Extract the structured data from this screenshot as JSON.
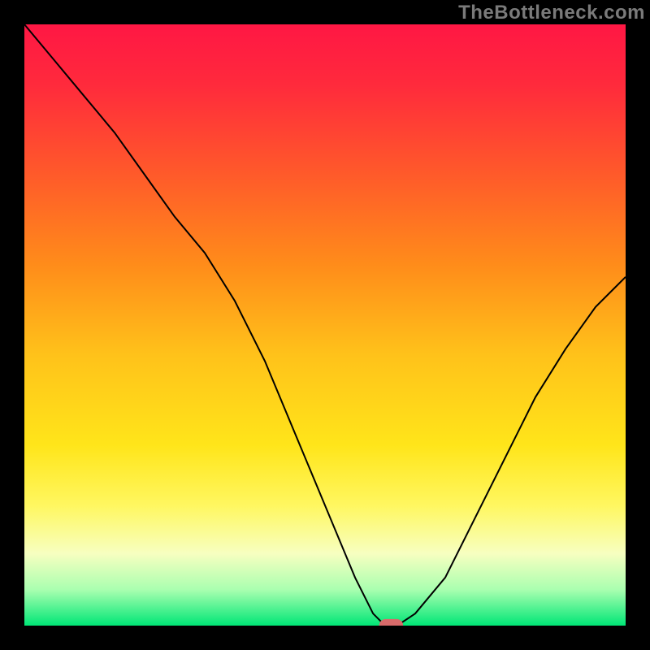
{
  "watermark": "TheBottleneck.com",
  "chart_data": {
    "type": "line",
    "title": "",
    "xlabel": "",
    "ylabel": "",
    "xlim": [
      0,
      100
    ],
    "ylim": [
      0,
      100
    ],
    "grid": false,
    "legend": false,
    "background": {
      "type": "vertical-gradient",
      "stops": [
        {
          "offset": 0.0,
          "color": "#ff1744"
        },
        {
          "offset": 0.1,
          "color": "#ff2a3c"
        },
        {
          "offset": 0.25,
          "color": "#ff5a2a"
        },
        {
          "offset": 0.4,
          "color": "#ff8c1a"
        },
        {
          "offset": 0.55,
          "color": "#ffc21a"
        },
        {
          "offset": 0.7,
          "color": "#ffe51a"
        },
        {
          "offset": 0.8,
          "color": "#fff760"
        },
        {
          "offset": 0.88,
          "color": "#f7ffc0"
        },
        {
          "offset": 0.94,
          "color": "#aaffb0"
        },
        {
          "offset": 1.0,
          "color": "#00e676"
        }
      ]
    },
    "series": [
      {
        "name": "bottleneck-curve",
        "color": "#000000",
        "stroke_width": 2,
        "x": [
          0,
          5,
          10,
          15,
          20,
          25,
          30,
          35,
          40,
          45,
          50,
          55,
          58,
          60,
          62,
          65,
          70,
          75,
          80,
          85,
          90,
          95,
          100
        ],
        "y": [
          100,
          94,
          88,
          82,
          75,
          68,
          62,
          54,
          44,
          32,
          20,
          8,
          2,
          0,
          0,
          2,
          8,
          18,
          28,
          38,
          46,
          53,
          58
        ]
      }
    ],
    "marker": {
      "name": "optimal-point",
      "x": 61,
      "y": 0,
      "color": "#d86a6a",
      "width": 4,
      "height": 2.2,
      "rx": 1.2
    },
    "frame": {
      "color": "#000000",
      "thickness": 30
    }
  }
}
